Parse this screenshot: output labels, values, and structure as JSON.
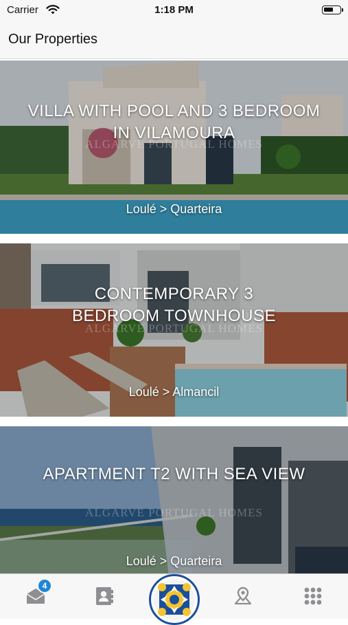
{
  "status": {
    "carrier": "Carrier",
    "time": "1:18 PM"
  },
  "nav": {
    "title": "Our Properties"
  },
  "properties": [
    {
      "title_line1": "VILLA WITH POOL AND 3 BEDROOM",
      "title_line2": "IN VILAMOURA",
      "location": "Loulé > Quarteira",
      "watermark": "ALGARVE PORTUGAL HOMES"
    },
    {
      "title_line1": "CONTEMPORARY 3",
      "title_line2": "BEDROOM TOWNHOUSE",
      "location": "Loulé > Almancil",
      "watermark": "ALGARVE PORTUGAL HOMES"
    },
    {
      "title_line1": "APARTMENT T2 WITH SEA VIEW",
      "title_line2": "",
      "location": "Loulé > Quarteira",
      "watermark": "ALGARVE PORTUGAL HOMES"
    }
  ],
  "tabbar": {
    "messages_badge": "4",
    "icons": [
      "envelope-open-icon",
      "contact-card-icon",
      "tile-logo",
      "map-pin-icon",
      "grid-icon"
    ]
  },
  "colors": {
    "accent": "#1f86d6",
    "icon_gray": "#8e8e93"
  }
}
